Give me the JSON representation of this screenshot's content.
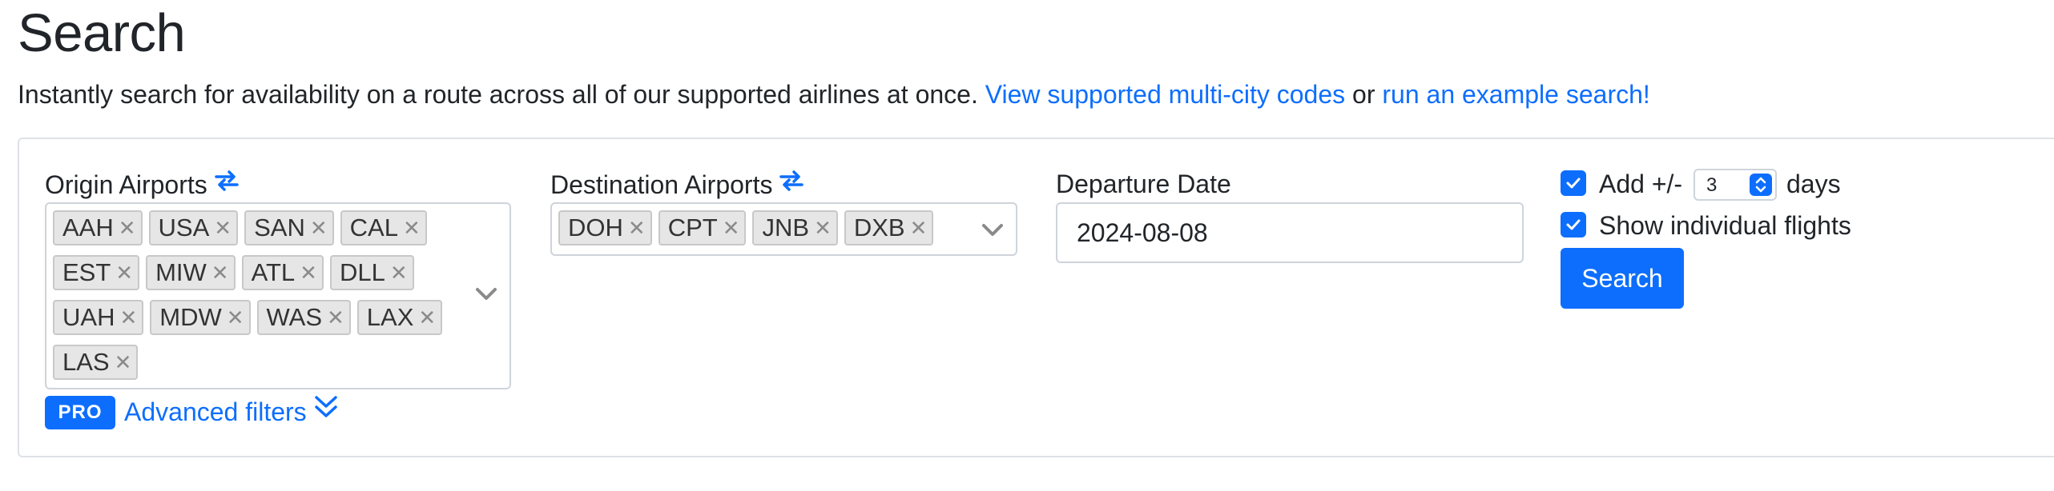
{
  "page": {
    "title": "Search",
    "lead_text": "Instantly search for availability on a route across all of our supported airlines at once.",
    "link_multicity": "View supported multi-city codes",
    "lead_or": "or",
    "link_example": "run an example search!"
  },
  "form": {
    "origin": {
      "label": "Origin Airports",
      "chips": [
        "AAH",
        "USA",
        "SAN",
        "CAL",
        "EST",
        "MIW",
        "ATL",
        "DLL",
        "UAH",
        "MDW",
        "WAS",
        "LAX",
        "LAS"
      ]
    },
    "destination": {
      "label": "Destination Airports",
      "chips": [
        "DOH",
        "CPT",
        "JNB",
        "DXB"
      ]
    },
    "departure": {
      "label": "Departure Date",
      "value": "2024-08-08"
    },
    "flex_days": {
      "checked": true,
      "prefix": "Add +/-",
      "value": "3",
      "suffix": "days"
    },
    "individual_flights": {
      "checked": true,
      "label": "Show individual flights"
    },
    "search_button": "Search",
    "pro_badge": "PRO",
    "advanced_filters": "Advanced filters"
  },
  "icons": {
    "swap": "swap-arrows-icon",
    "chip_remove": "remove-x-icon",
    "dropdown": "chevron-down-icon",
    "advanced": "double-chevron-down-icon",
    "check": "check-icon"
  },
  "colors": {
    "accent": "#0d6efd",
    "text": "#212529",
    "chip_bg": "#e6e6e6",
    "border": "#dee2e6"
  }
}
